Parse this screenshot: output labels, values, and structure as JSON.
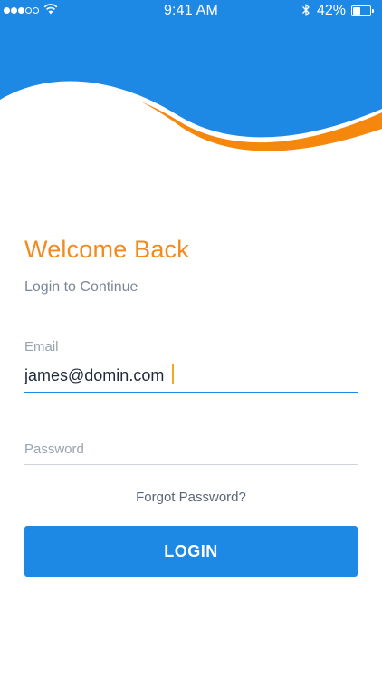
{
  "status_bar": {
    "time": "9:41 AM",
    "battery_percent": "42%",
    "battery_level": 0.42,
    "signal_bars_filled": 3,
    "signal_bars_total": 5,
    "wifi_icon": "wifi-icon",
    "bluetooth_icon": "bluetooth-icon"
  },
  "colors": {
    "primary_blue": "#1e88e5",
    "accent_orange": "#f28a1e",
    "caret": "#f5a623"
  },
  "login": {
    "title": "Welcome Back",
    "subtitle": "Login to Continue",
    "email": {
      "label": "Email",
      "value": "james@domin.com"
    },
    "password": {
      "placeholder": "Password",
      "value": ""
    },
    "forgot_password": "Forgot Password?",
    "submit_label": "LOGIN"
  }
}
